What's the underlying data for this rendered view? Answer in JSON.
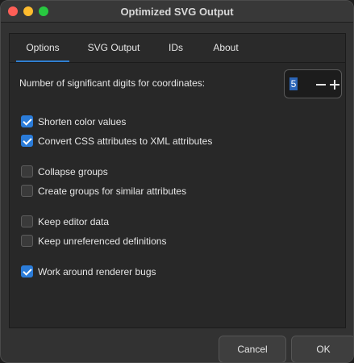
{
  "window": {
    "title": "Optimized SVG Output"
  },
  "tabs": [
    {
      "label": "Options",
      "selected": true
    },
    {
      "label": "SVG Output",
      "selected": false
    },
    {
      "label": "IDs",
      "selected": false
    },
    {
      "label": "About",
      "selected": false
    }
  ],
  "options": {
    "digits": {
      "label": "Number of significant digits for coordinates:",
      "value": "5"
    },
    "items": [
      {
        "label": "Shorten color values",
        "checked": true
      },
      {
        "label": "Convert CSS attributes to XML attributes",
        "checked": true
      },
      {
        "label": "Collapse groups",
        "checked": false
      },
      {
        "label": "Create groups for similar attributes",
        "checked": false
      },
      {
        "label": "Keep editor data",
        "checked": false
      },
      {
        "label": "Keep unreferenced definitions",
        "checked": false
      },
      {
        "label": "Work around renderer bugs",
        "checked": true
      }
    ]
  },
  "buttons": {
    "cancel": "Cancel",
    "ok": "OK"
  },
  "colors": {
    "accent": "#2b7cd9",
    "tab_underline": "#2f7fd1",
    "close": "#ff5f57",
    "minimize": "#febc2e",
    "maximize": "#28c840"
  }
}
